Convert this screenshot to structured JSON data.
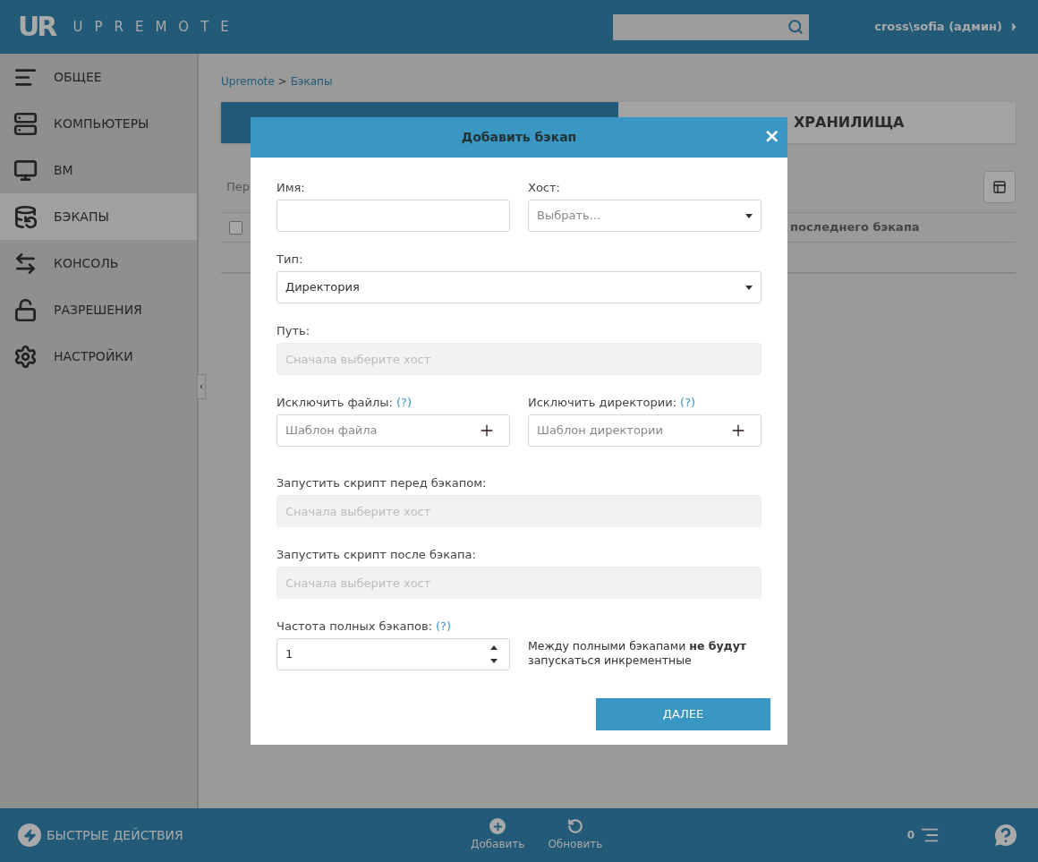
{
  "header": {
    "logo_mark": "UR",
    "logo_text": "UPREMOTE",
    "user": "cross\\sofia (админ)"
  },
  "sidebar": {
    "items": [
      {
        "label": "ОБЩЕЕ",
        "kind": "general",
        "selected": false
      },
      {
        "label": "КОМПЬЮТЕРЫ",
        "kind": "computers",
        "selected": false
      },
      {
        "label": "ВМ",
        "kind": "vm",
        "selected": false
      },
      {
        "label": "БЭКАПЫ",
        "kind": "backups",
        "selected": true
      },
      {
        "label": "КОНСОЛЬ",
        "kind": "console",
        "selected": false
      },
      {
        "label": "РАЗРЕШЕНИЯ",
        "kind": "permissions",
        "selected": false
      },
      {
        "label": "НАСТРОЙКИ",
        "kind": "settings",
        "selected": false
      }
    ]
  },
  "breadcrumb": {
    "root": "Upremote",
    "separator": ">",
    "current": "Бэкапы"
  },
  "tabs": [
    {
      "selected": true
    },
    {
      "label": "ХРАНИЛИЩА",
      "selected": false
    }
  ],
  "toolbar": {
    "text": "Пер"
  },
  "table": {
    "select_all": {
      "checked": false
    },
    "columns": [
      {
        "label": "последнего бэкапа"
      }
    ]
  },
  "modal": {
    "title": "Добавить бэкап",
    "close": "×",
    "rows": [
      [
        {
          "kind": "text",
          "label": "Имя:"
        },
        {
          "kind": "select",
          "label": "Хост:",
          "placeholder": "Выбрать..."
        }
      ],
      [
        {
          "kind": "select",
          "label": "Тип:",
          "value": "Директория"
        }
      ],
      [
        {
          "kind": "disabled",
          "label": "Путь:",
          "placeholder": "Сначала выберите хост"
        }
      ],
      [
        {
          "kind": "pattern",
          "label": "Исключить файлы:",
          "help": "(?)",
          "placeholder": "Шаблон файла"
        },
        {
          "kind": "pattern",
          "label": "Исключить директории:",
          "help": "(?)",
          "placeholder": "Шаблон директории"
        }
      ],
      [
        {
          "kind": "disabled",
          "label": "Запустить скрипт перед бэкапом:",
          "placeholder": "Сначала выберите хост"
        }
      ],
      [
        {
          "kind": "disabled",
          "label": "Запустить скрипт после бэкапа:",
          "placeholder": "Сначала выберите хост"
        }
      ],
      [
        {
          "kind": "number",
          "label": "Частота полных бэкапов:",
          "help": "(?)",
          "value": "1"
        },
        {
          "kind": "note",
          "text": "Между полными бэкапами **не будут** запускаться инкрементные"
        }
      ]
    ],
    "submit": "ДАЛЕЕ"
  },
  "footer": {
    "quick_actions": "БЫСТРЫЕ ДЕЙСТВИЯ",
    "actions": [
      {
        "label": "Добавить",
        "kind": "add"
      },
      {
        "label": "Обновить",
        "kind": "refresh"
      }
    ],
    "count": "0"
  }
}
